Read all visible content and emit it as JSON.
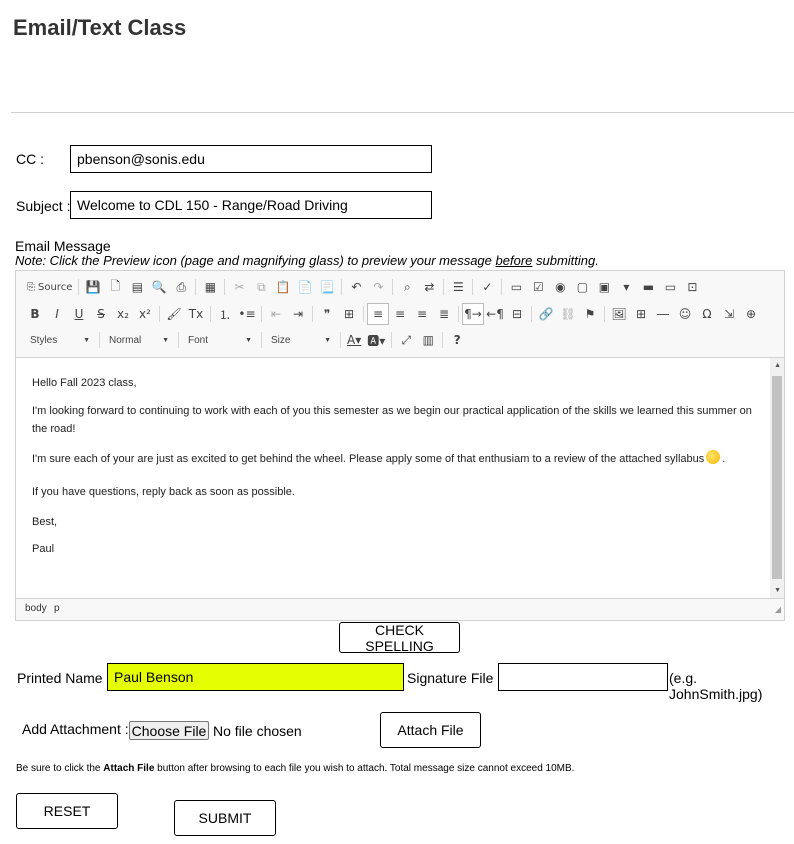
{
  "page": {
    "title": "Email/Text Class"
  },
  "cc": {
    "label": "CC :",
    "value": "pbenson@sonis.edu"
  },
  "subject": {
    "label": "Subject :",
    "value": "Welcome to CDL 150 - Range/Road Driving"
  },
  "message": {
    "label": "Email Message",
    "note_prefix": "Note: Click the Preview icon (page and magnifying glass) to preview your message ",
    "note_emph": "before",
    "note_suffix": " submitting."
  },
  "editor": {
    "toolbar": {
      "source_label": "Source",
      "styles_label": "Styles",
      "format_label": "Normal",
      "font_label": "Font",
      "size_label": "Size"
    },
    "body": [
      "Hello Fall 2023 class,",
      "I'm looking forward to continuing to work with each of you this semester as we begin our practical application of the skills we learned this summer on the road!",
      "I'm sure each of your are just as excited to get behind the wheel. Please apply some of that enthusiam to a review of the attached syllabus",
      "If you have questions, reply back as soon as possible.",
      "Best,",
      "Paul"
    ],
    "path": [
      "body",
      "p"
    ]
  },
  "buttons": {
    "check_spelling": "CHECK SPELLING",
    "attach_file": "Attach File",
    "reset": "RESET",
    "submit": "SUBMIT"
  },
  "printed_name": {
    "label": "Printed Name",
    "value": "Paul Benson"
  },
  "signature": {
    "label": "Signature File",
    "value": "",
    "example": "(e.g. JohnSmith.jpg)"
  },
  "attachment": {
    "label": "Add Attachment :",
    "choose_label": "Choose File",
    "status": "No file chosen",
    "help_prefix": "Be sure to click the ",
    "help_bold": "Attach File",
    "help_suffix": " button after browsing to each file you wish to attach.  Total message size cannot exceed 10MB."
  },
  "colors": {
    "printed_name_bg": "#e6ff00"
  }
}
